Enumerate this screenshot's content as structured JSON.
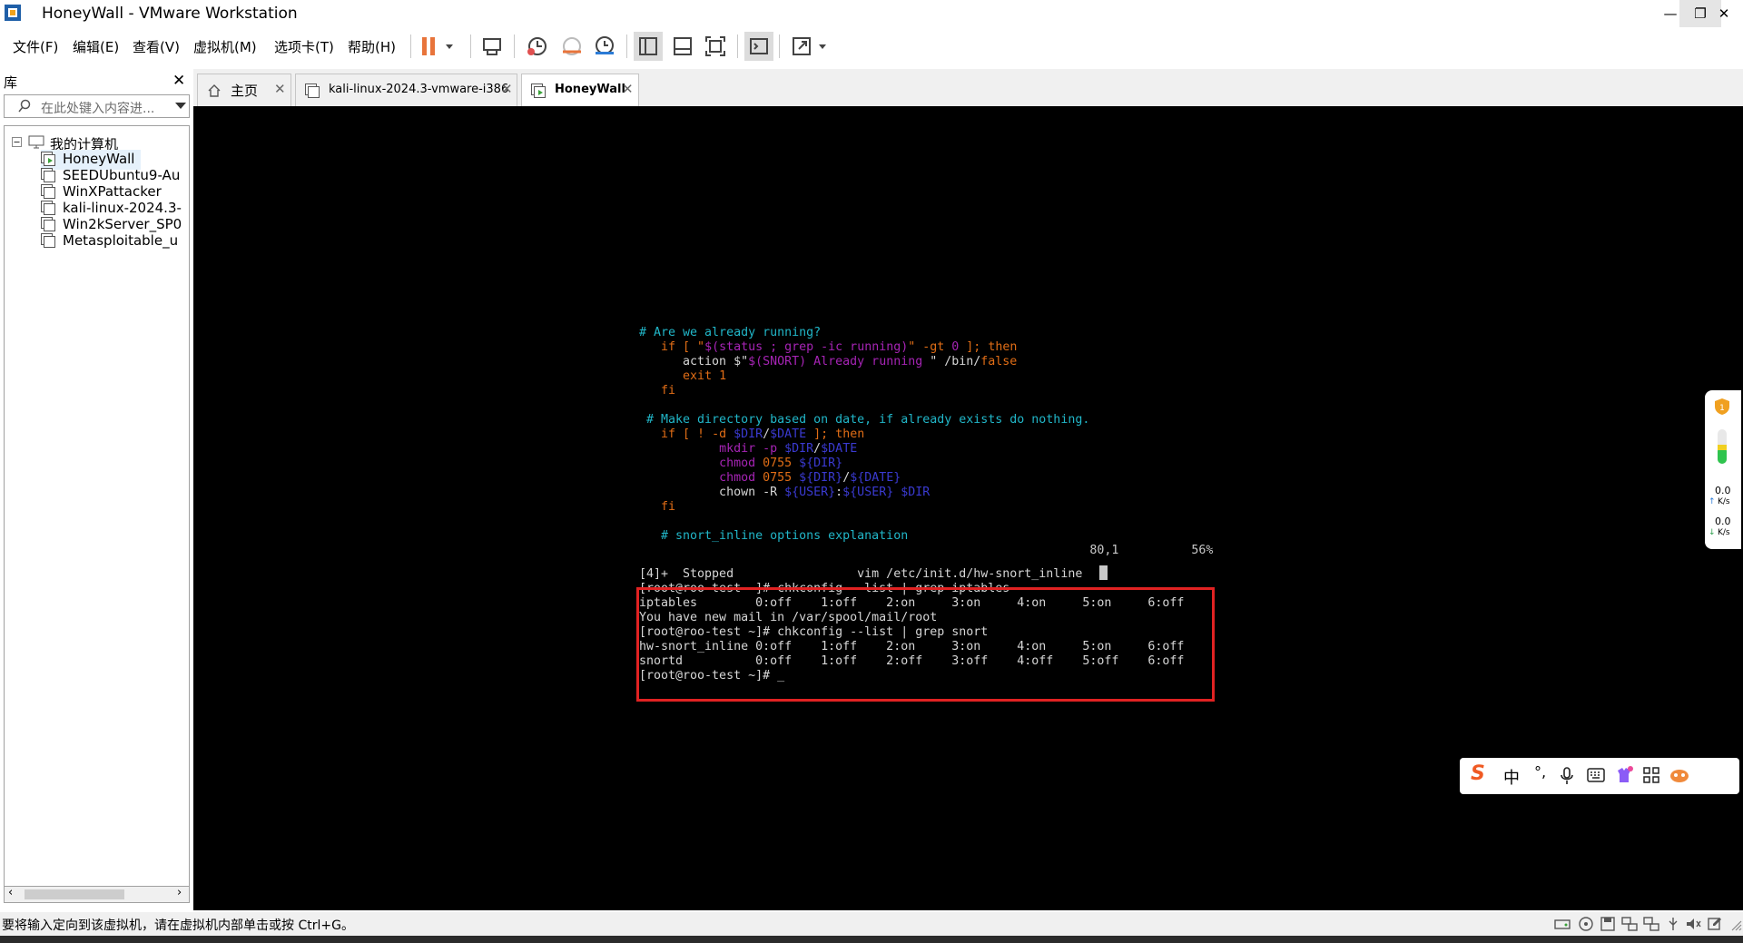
{
  "window": {
    "title": "HoneyWall - VMware Workstation",
    "minimize": "—",
    "restore": "❐",
    "close": "✕"
  },
  "menu": [
    "文件(F)",
    "编辑(E)",
    "查看(V)",
    "虚拟机(M)",
    "选项卡(T)",
    "帮助(H)"
  ],
  "library": {
    "title": "库",
    "close": "✕",
    "search_placeholder": "在此处键入内容进...",
    "root": "我的计算机",
    "vms": [
      "HoneyWall",
      "SEEDUbuntu9-Au",
      "WinXPattacker",
      "kali-linux-2024.3-",
      "Win2kServer_SP0",
      "Metasploitable_u"
    ],
    "selected": "HoneyWall"
  },
  "tabs": [
    {
      "label": "主页",
      "close": "✕"
    },
    {
      "label": "kali-linux-2024.3-vmware-i386",
      "close": "✕"
    },
    {
      "label": "HoneyWall",
      "close": "✕"
    }
  ],
  "terminal": {
    "vim_lines": [
      {
        "segs": [
          {
            "t": "# Are we already running?",
            "c": "cyan"
          }
        ]
      },
      {
        "segs": [
          {
            "t": "   ",
            "c": "white"
          },
          {
            "t": "if [ \"",
            "c": "orange"
          },
          {
            "t": "$(status ; grep -ic running)",
            "c": "purple"
          },
          {
            "t": "\" -gt ",
            "c": "orange"
          },
          {
            "t": "0",
            "c": "purple"
          },
          {
            "t": " ]; then",
            "c": "orange"
          }
        ]
      },
      {
        "segs": [
          {
            "t": "      action $\"",
            "c": "white"
          },
          {
            "t": "$(SNORT) Already running ",
            "c": "purple"
          },
          {
            "t": "\" /bin/",
            "c": "white"
          },
          {
            "t": "false",
            "c": "orange"
          }
        ]
      },
      {
        "segs": [
          {
            "t": "      ",
            "c": "white"
          },
          {
            "t": "exit 1",
            "c": "orange"
          }
        ]
      },
      {
        "segs": [
          {
            "t": "   fi",
            "c": "orange"
          }
        ]
      },
      {
        "segs": [
          {
            "t": "",
            "c": "white"
          }
        ]
      },
      {
        "segs": [
          {
            "t": " # Make directory based on date, if already exists do nothing.",
            "c": "cyan"
          }
        ]
      },
      {
        "segs": [
          {
            "t": "   ",
            "c": "white"
          },
          {
            "t": "if [ ! -d ",
            "c": "orange"
          },
          {
            "t": "$DIR",
            "c": "blue"
          },
          {
            "t": "/",
            "c": "white"
          },
          {
            "t": "$DATE",
            "c": "blue"
          },
          {
            "t": " ]; then",
            "c": "orange"
          }
        ]
      },
      {
        "segs": [
          {
            "t": "           ",
            "c": "white"
          },
          {
            "t": "mkdir -p ",
            "c": "purple"
          },
          {
            "t": "$DIR",
            "c": "blue"
          },
          {
            "t": "/",
            "c": "white"
          },
          {
            "t": "$DATE",
            "c": "blue"
          }
        ]
      },
      {
        "segs": [
          {
            "t": "           ",
            "c": "white"
          },
          {
            "t": "chmod ",
            "c": "purple"
          },
          {
            "t": "0755 ",
            "c": "orange"
          },
          {
            "t": "${DIR}",
            "c": "blue"
          }
        ]
      },
      {
        "segs": [
          {
            "t": "           ",
            "c": "white"
          },
          {
            "t": "chmod ",
            "c": "purple"
          },
          {
            "t": "0755 ",
            "c": "orange"
          },
          {
            "t": "${DIR}",
            "c": "blue"
          },
          {
            "t": "/",
            "c": "white"
          },
          {
            "t": "${DATE}",
            "c": "blue"
          }
        ]
      },
      {
        "segs": [
          {
            "t": "           chown -R ",
            "c": "white"
          },
          {
            "t": "${USER}",
            "c": "blue"
          },
          {
            "t": ":",
            "c": "white"
          },
          {
            "t": "${USER}",
            "c": "blue"
          },
          {
            "t": " ",
            "c": "white"
          },
          {
            "t": "$DIR",
            "c": "blue"
          }
        ]
      },
      {
        "segs": [
          {
            "t": "   fi",
            "c": "orange"
          }
        ]
      },
      {
        "segs": [
          {
            "t": "",
            "c": "white"
          }
        ]
      },
      {
        "segs": [
          {
            "t": "   # snort_inline options explanation",
            "c": "cyan"
          }
        ]
      }
    ],
    "ruler": "                                                              80,1          56%",
    "shell_lines": [
      "[4]+  Stopped                 vim /etc/init.d/hw-snort_inline",
      "[root@roo-test ~]# chkconfig --list | grep iptables",
      "iptables        0:off    1:off    2:on     3:on     4:on     5:on     6:off",
      "You have new mail in /var/spool/mail/root",
      "[root@roo-test ~]# chkconfig --list | grep snort",
      "hw-snort_inline 0:off    1:off    2:on     3:on     4:on     5:on     6:off",
      "snortd          0:off    1:off    2:off    3:off    4:off    5:off    6:off",
      "[root@roo-test ~]# _"
    ]
  },
  "side_widget": {
    "up_rate": "0.0",
    "up_unit": "K/s",
    "down_rate": "0.0",
    "down_unit": "K/s"
  },
  "ime": {
    "input_mode": "中",
    "punct": "°,"
  },
  "status": {
    "text": "要将输入定向到该虚拟机，请在虚拟机内部单击或按 Ctrl+G。"
  },
  "colors": {
    "terminal_bg": "#000000",
    "highlight_box": "#e02222",
    "pause_icon": "#e8743b"
  }
}
